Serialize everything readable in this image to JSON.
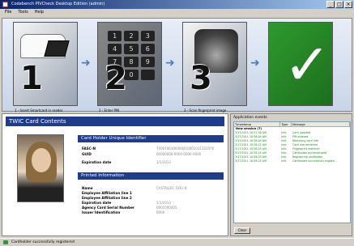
{
  "window": {
    "title": "Codebench PIVCheck Desktop Edition (admin)"
  },
  "menu": [
    "File",
    "Tools",
    "Help"
  ],
  "steps": [
    {
      "number": "1",
      "caption": "1 - Insert Smartcard in reader"
    },
    {
      "number": "2",
      "caption": "2 - Enter PIN"
    },
    {
      "number": "3",
      "caption": "3 - Scan fingerprint image"
    }
  ],
  "keypad": [
    "1",
    "2",
    "3",
    "4",
    "5",
    "6",
    "7",
    "8",
    "9",
    "",
    "0",
    ""
  ],
  "twic": {
    "header": "TWIC Card Contents",
    "unique_identifier_title": "Card Holder Unique Identifier",
    "fasc_label": "FASC-N",
    "fasc_value": "7000706300000810001031322070",
    "guid_label": "GUID",
    "guid_value": "00000000-0000-0000-0000",
    "expiration_label": "Expiration date",
    "expiration_value": "1/1/2013",
    "printed_title": "Printed Information",
    "name_label": "Name",
    "name_value": "CASTALDO, GOLI B",
    "affil1_label": "Employee Affiliation line 1",
    "affil2_label": "Employee Affiliation line 2",
    "printed_exp_label": "Expiration date",
    "printed_exp_value": "1/1/2013",
    "serial_label": "Agency Card Serial Number",
    "serial_value": "0001000405",
    "issuer_label": "Issuer Identification",
    "issuer_value": "0000"
  },
  "events": {
    "title": "Application events",
    "columns": [
      "Timestamp",
      "Type",
      "Message"
    ],
    "session": "New session (7)",
    "rows": [
      [
        "3/17/2011 10:57:58 AM",
        "Info",
        "Card inserted"
      ],
      [
        "3/17/2011 10:58:04 AM",
        "Info",
        "PIN entered"
      ],
      [
        "3/17/2011 10:58:04 AM",
        "Info",
        "Removing card info"
      ],
      [
        "3/17/2011 10:58:21 AM",
        "Info",
        "Card info retrieved"
      ],
      [
        "3/17/2011 10:58:25 AM",
        "Info",
        "Fingerprint matched"
      ],
      [
        "3/17/2011 10:58:25 AM",
        "Info",
        "Cardholder authenticated"
      ],
      [
        "3/17/2011 10:58:25 AM",
        "Info",
        "Registering cardholder"
      ],
      [
        "3/17/2011 10:58:25 AM",
        "Info",
        "Cardholder successfully registe..."
      ]
    ],
    "clear_label": "Clear"
  },
  "status": {
    "text": "Cardholder successfully registered"
  }
}
